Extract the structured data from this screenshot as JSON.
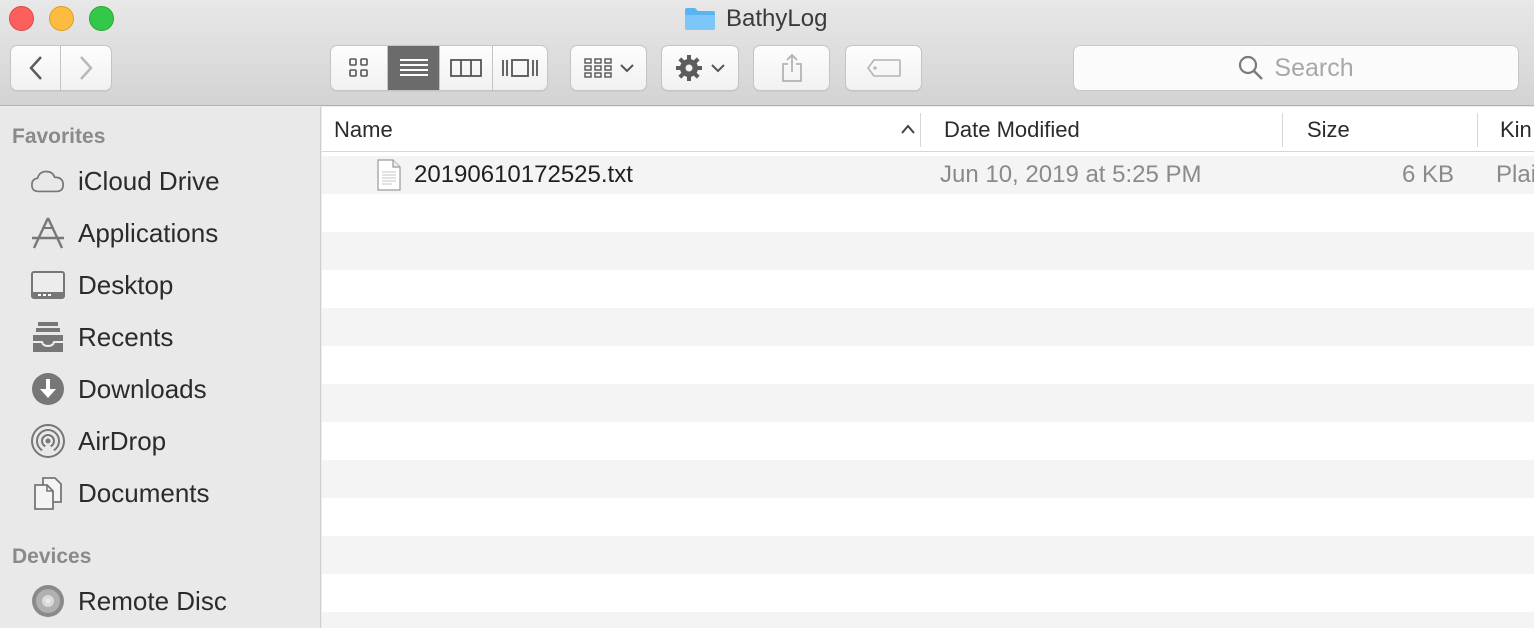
{
  "window": {
    "title": "BathyLog"
  },
  "search": {
    "placeholder": "Search"
  },
  "sidebar": {
    "sections": [
      {
        "heading": "Favorites",
        "items": [
          {
            "label": "iCloud Drive",
            "icon": "cloud-icon"
          },
          {
            "label": "Applications",
            "icon": "applications-icon"
          },
          {
            "label": "Desktop",
            "icon": "desktop-icon"
          },
          {
            "label": "Recents",
            "icon": "recents-icon"
          },
          {
            "label": "Downloads",
            "icon": "downloads-icon"
          },
          {
            "label": "AirDrop",
            "icon": "airdrop-icon"
          },
          {
            "label": "Documents",
            "icon": "documents-icon"
          }
        ]
      },
      {
        "heading": "Devices",
        "items": [
          {
            "label": "Remote Disc",
            "icon": "disc-icon"
          }
        ]
      }
    ]
  },
  "columns": {
    "name": "Name",
    "date_modified": "Date Modified",
    "size": "Size",
    "kind": "Kin"
  },
  "files": [
    {
      "name": "20190610172525.txt",
      "date_modified": "Jun 10, 2019 at 5:25 PM",
      "size": "6 KB",
      "kind": "Plai",
      "icon": "text-document-icon"
    }
  ],
  "colors": {
    "folder": "#5ab4f0",
    "active_segment": "#6b6b6b",
    "close": "#fc605c",
    "minimize": "#fdbc40",
    "maximize": "#34c84a"
  }
}
